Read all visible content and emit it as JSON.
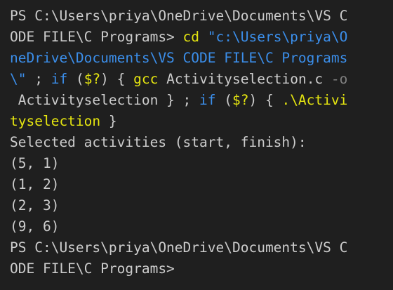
{
  "terminal": {
    "colors": {
      "background": "#1f1f1f",
      "default": "#cccccc",
      "command": "#e5e510",
      "string": "#3b8eea",
      "operator": "#cccccc",
      "keyword": "#3b8eea",
      "param": "#808080"
    },
    "lines": [
      [
        {
          "t": "PS C:\\Users\\priya\\OneDrive\\Documents\\VS C",
          "c": "default"
        }
      ],
      [
        {
          "t": "ODE FILE\\C Programs> ",
          "c": "default"
        },
        {
          "t": "cd",
          "c": "command"
        },
        {
          "t": " ",
          "c": "default"
        },
        {
          "t": "\"c:\\Users\\priya\\O",
          "c": "string"
        }
      ],
      [
        {
          "t": "neDrive\\Documents\\VS CODE FILE\\C Programs",
          "c": "string"
        }
      ],
      [
        {
          "t": "\\\"",
          "c": "string"
        },
        {
          "t": " ; ",
          "c": "default"
        },
        {
          "t": "if",
          "c": "keyword"
        },
        {
          "t": " (",
          "c": "default"
        },
        {
          "t": "$?",
          "c": "command"
        },
        {
          "t": ") { ",
          "c": "default"
        },
        {
          "t": "gcc",
          "c": "command"
        },
        {
          "t": " Activityselection.c ",
          "c": "default"
        },
        {
          "t": "-o",
          "c": "param"
        }
      ],
      [
        {
          "t": " Activityselection } ; ",
          "c": "default"
        },
        {
          "t": "if",
          "c": "keyword"
        },
        {
          "t": " (",
          "c": "default"
        },
        {
          "t": "$?",
          "c": "command"
        },
        {
          "t": ") { ",
          "c": "default"
        },
        {
          "t": ".\\Activi",
          "c": "command"
        }
      ],
      [
        {
          "t": "tyselection",
          "c": "command"
        },
        {
          "t": " }",
          "c": "default"
        }
      ],
      [
        {
          "t": "Selected activities (start, finish):",
          "c": "default"
        }
      ],
      [
        {
          "t": "(5, 1)",
          "c": "default"
        }
      ],
      [
        {
          "t": "(1, 2)",
          "c": "default"
        }
      ],
      [
        {
          "t": "(2, 3)",
          "c": "default"
        }
      ],
      [
        {
          "t": "(9, 6)",
          "c": "default"
        }
      ],
      [
        {
          "t": "PS C:\\Users\\priya\\OneDrive\\Documents\\VS C",
          "c": "default"
        }
      ],
      [
        {
          "t": "ODE FILE\\C Programs>",
          "c": "default"
        }
      ]
    ]
  }
}
